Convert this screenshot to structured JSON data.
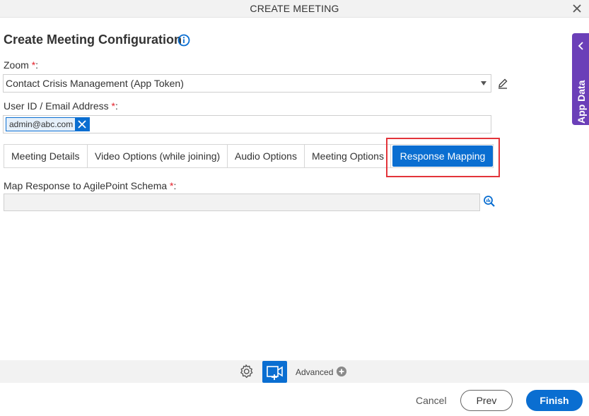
{
  "window": {
    "title": "CREATE MEETING"
  },
  "config": {
    "heading": "Create Meeting Configuration"
  },
  "zoom": {
    "label": "Zoom",
    "required_mark": "*",
    "colon": ":",
    "selected": "Contact Crisis Management (App Token)"
  },
  "user": {
    "label": "User ID / Email Address",
    "required_mark": "*",
    "colon": ":",
    "tag": "admin@abc.com"
  },
  "tabs": [
    {
      "label": "Meeting Details"
    },
    {
      "label": "Video Options (while joining)"
    },
    {
      "label": "Audio Options"
    },
    {
      "label": "Meeting Options"
    },
    {
      "label": "Response Mapping",
      "active": true
    }
  ],
  "schema": {
    "label": "Map Response to AgilePoint Schema",
    "required_mark": "*",
    "colon": ":",
    "value": ""
  },
  "side_panel": {
    "label": "App Data"
  },
  "toolbar": {
    "advanced_label": "Advanced"
  },
  "footer": {
    "cancel": "Cancel",
    "prev": "Prev",
    "finish": "Finish"
  },
  "colors": {
    "accent": "#0a6ed1",
    "side_tab": "#6b3fb8",
    "highlight": "#e3343a",
    "required": "#e4202a"
  }
}
